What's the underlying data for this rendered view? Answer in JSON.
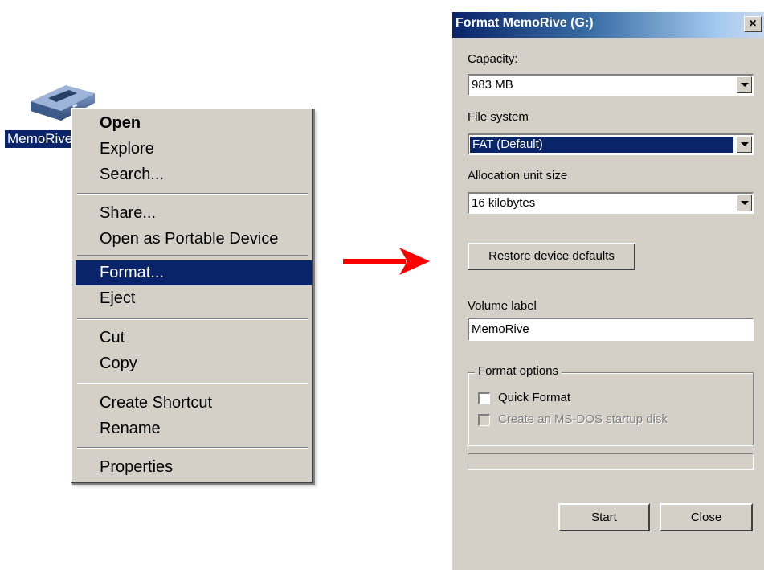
{
  "desktop": {
    "drive_label": "MemoRive",
    "drive_icon": "usb-drive-icon"
  },
  "context_menu": {
    "items": [
      {
        "label": "Open",
        "bold": true
      },
      {
        "label": "Explore"
      },
      {
        "label": "Search..."
      },
      {
        "label": "Share..."
      },
      {
        "label": "Open as Portable Device"
      },
      {
        "label": "Format...",
        "highlighted": true
      },
      {
        "label": "Eject"
      },
      {
        "label": "Cut"
      },
      {
        "label": "Copy"
      },
      {
        "label": "Create Shortcut"
      },
      {
        "label": "Rename"
      },
      {
        "label": "Properties"
      }
    ],
    "highlight_color": "#0a246a"
  },
  "arrow": {
    "icon": "right-arrow-icon",
    "color": "#ff0000"
  },
  "dialog": {
    "title": "Format MemoRive (G:)",
    "close_glyph": "×",
    "capacity_label": "Capacity:",
    "capacity_value": "983 MB",
    "filesystem_label": "File system",
    "filesystem_value": "FAT (Default)",
    "allocation_label": "Allocation unit size",
    "allocation_value": "16 kilobytes",
    "restore_button": "Restore device defaults",
    "volume_label_label": "Volume label",
    "volume_label_value": "MemoRive",
    "format_options_title": "Format options",
    "quick_format_label": "Quick Format",
    "quick_format_checked": false,
    "msdos_label": "Create an MS-DOS startup disk",
    "msdos_checked": false,
    "msdos_enabled": false,
    "progress": 0,
    "start_button": "Start",
    "close_button": "Close"
  }
}
